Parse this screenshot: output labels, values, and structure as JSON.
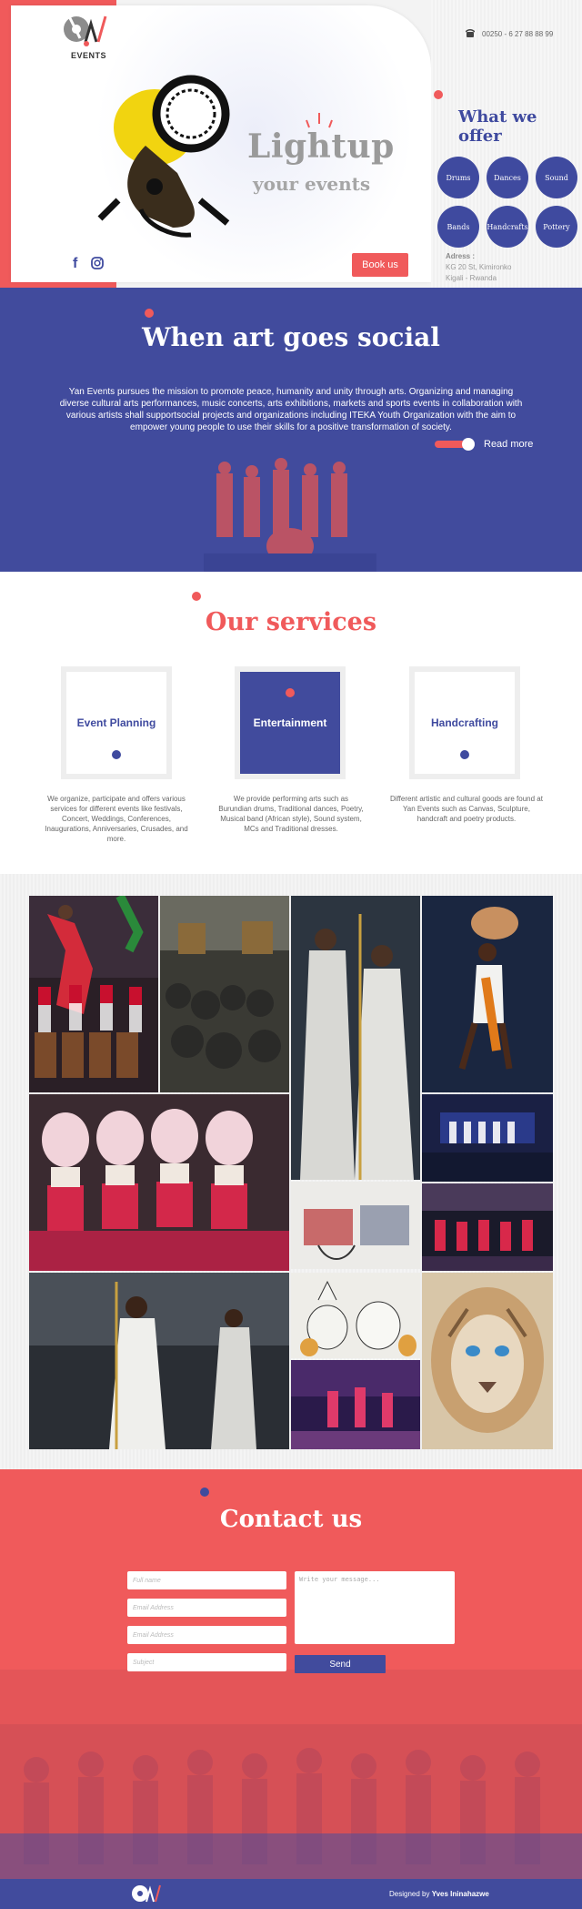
{
  "brand": {
    "logo_text": "EVENTS"
  },
  "hero": {
    "title": "Lightup",
    "subtitle": "your events",
    "book_button": "Book us",
    "social_icons": [
      "facebook-icon",
      "instagram-icon"
    ]
  },
  "contact_info": {
    "phone": "00250 - 6 27 88 88 99",
    "address_label": "Adress :",
    "address_line1": "KG 20 St, Kimironko",
    "address_line2": "Kigali - Rwanda"
  },
  "offer": {
    "title": "What we offer",
    "items": [
      "Drums",
      "Dances",
      "Sound",
      "Bands",
      "Handcrafts",
      "Pottery"
    ]
  },
  "about": {
    "title": "When art goes social",
    "text": "Yan Events pursues the mission to promote peace, humanity and unity through arts. Organizing and managing diverse cultural arts performances, music concerts, arts exhibitions, markets and sports events in collaboration with various artists shall supportsocial projects and organizations including ITEKA Youth Organization with the aim to empower young people to use their skills for a positive transformation of society.",
    "read_more": "Read more"
  },
  "services": {
    "title": "Our services",
    "items": [
      {
        "label": "Event Planning",
        "desc": "We organize, participate and offers various services for different events like festivals, Concert, Weddings, Conferences, Inaugurations, Anniversaries, Crusades, and more."
      },
      {
        "label": "Entertainment",
        "desc": "We provide performing arts such as Burundian drums, Traditional dances, Poetry, Musical band (African style), Sound system, MCs and Traditional dresses."
      },
      {
        "label": "Handcrafting",
        "desc": "Different artistic and cultural goods are found at Yan Events such as Canvas, Sculpture, handcraft and poetry products."
      }
    ]
  },
  "contact": {
    "title": "Contact us",
    "fullname_placeholder": "Full name",
    "email_placeholder": "Email Address",
    "email2_placeholder": "Email Address",
    "subject_placeholder": "Subject",
    "message_placeholder": "Write your message...",
    "send_label": "Send"
  },
  "footer": {
    "credit_prefix": "Designed by ",
    "credit_name": "Yves Ininahazwe"
  },
  "colors": {
    "red": "#f05a5b",
    "blue": "#414b9d"
  }
}
